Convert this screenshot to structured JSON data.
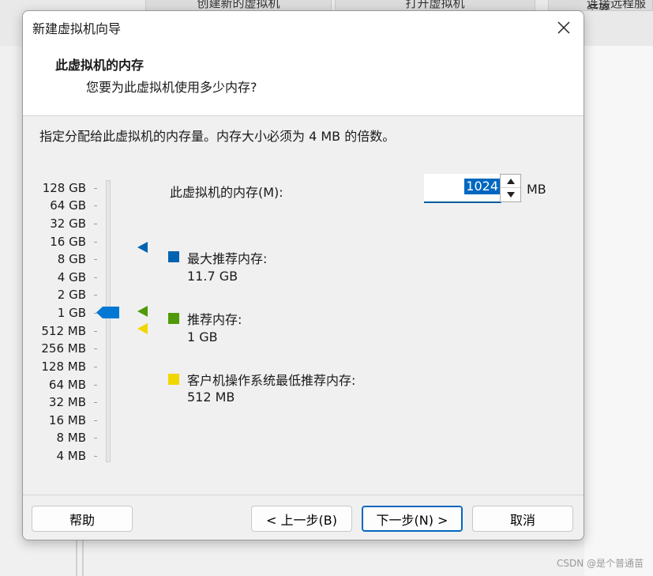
{
  "background": {
    "tabs": [
      "创建新的虚拟机",
      "打开虚拟机",
      "连接远程服务器"
    ],
    "watermark": "CSDN @是个普通苗"
  },
  "dialog": {
    "title": "新建虚拟机向导",
    "header_title": "此虚拟机的内存",
    "header_subtitle": "您要为此虚拟机使用多少内存?",
    "instruction": "指定分配给此虚拟机的内存量。内存大小必须为 4 MB 的倍数。",
    "scale_labels": [
      "128 GB",
      "64 GB",
      "32 GB",
      "16 GB",
      "8 GB",
      "4 GB",
      "2 GB",
      "1 GB",
      "512 MB",
      "256 MB",
      "128 MB",
      "64 MB",
      "32 MB",
      "16 MB",
      "8 MB",
      "4 MB"
    ],
    "slider_selected": "1 GB",
    "memory_label": "此虚拟机的内存(M):",
    "memory_value": "1024",
    "memory_unit": "MB",
    "legend": [
      {
        "label": "最大推荐内存:",
        "value": "11.7 GB",
        "color": "#0063b1"
      },
      {
        "label": "推荐内存:",
        "value": "1 GB",
        "color": "#4e9a06"
      },
      {
        "label": "客户机操作系统最低推荐内存:",
        "value": "512 MB",
        "color": "#f2d600"
      }
    ],
    "buttons": {
      "help": "帮助",
      "back": "< 上一步(B)",
      "next": "下一步(N) >",
      "cancel": "取消"
    },
    "accent_color": "#0067c0"
  }
}
